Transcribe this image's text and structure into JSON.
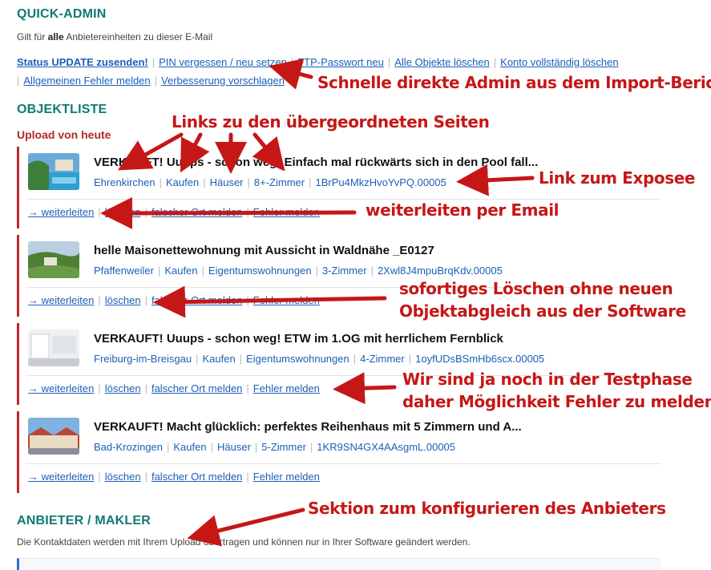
{
  "quick_admin": {
    "title": "QUICK-ADMIN",
    "subtitle_pre": "Gilt für ",
    "subtitle_bold": "alle",
    "subtitle_post": " Anbietereinheiten zu dieser E-Mail",
    "links": [
      "Status UPDATE zusenden!",
      "PIN vergessen / neu setzen",
      "FTP-Passwort neu",
      "Alle Objekte löschen",
      "Konto vollständig löschen",
      "Allgemeinen Fehler melden",
      "Verbesserung vorschlagen"
    ]
  },
  "objektliste": {
    "title": "OBJEKTLISTE",
    "upload_heading": "Upload von heute",
    "listings": [
      {
        "title": "VERKAUFT! Uuups - schon weg: Einfach mal rückwärts sich in den Pool fall...",
        "city": "Ehrenkirchen",
        "deal": "Kaufen",
        "type": "Häuser",
        "rooms": "8+-Zimmer",
        "id": "1BrPu4MkzHvoYvPQ.00005",
        "actions": [
          "→ weiterleiten",
          "löschen",
          "falscher Ort melden",
          "Fehler melden"
        ]
      },
      {
        "title": "helle Maisonettewohnung mit Aussicht in Waldnähe _E0127",
        "city": "Pfaffenweiler",
        "deal": "Kaufen",
        "type": "Eigentumswohnungen",
        "rooms": "3-Zimmer",
        "id": "2Xwl8J4mpuBrqKdv.00005",
        "actions": [
          "→ weiterleiten",
          "löschen",
          "falscher Ort melden",
          "Fehler melden"
        ]
      },
      {
        "title": "VERKAUFT! Uuups - schon weg! ETW im 1.OG mit herrlichem Fernblick",
        "city": "Freiburg-im-Breisgau",
        "deal": "Kaufen",
        "type": "Eigentumswohnungen",
        "rooms": "4-Zimmer",
        "id": "1oyfUDsBSmHb6scx.00005",
        "actions": [
          "→ weiterleiten",
          "löschen",
          "falscher Ort melden",
          "Fehler melden"
        ]
      },
      {
        "title": "VERKAUFT! Macht glücklich: perfektes Reihenhaus mit 5 Zimmern und A...",
        "city": "Bad-Krozingen",
        "deal": "Kaufen",
        "type": "Häuser",
        "rooms": "5-Zimmer",
        "id": "1KR9SN4GX4AAsgmL.00005",
        "actions": [
          "→ weiterleiten",
          "löschen",
          "falscher Ort melden",
          "Fehler melden"
        ]
      }
    ]
  },
  "anbieter": {
    "title": "ANBIETER / MAKLER",
    "subtitle": "Die Kontaktdaten werden mit Ihrem Upload übertragen und können nur in Ihrer Software geändert werden."
  },
  "annotations": {
    "admin": "Schnelle direkte Admin aus dem Import-Bericht",
    "parent_links": "Links zu den übergeordneten Seiten",
    "expose": "Link zum Exposee",
    "forward": "weiterleiten per Email",
    "delete_line1": "sofortiges Löschen ohne neuen",
    "delete_line2": "Objektabgleich aus der Software",
    "report_line1": "Wir sind ja noch in der Testphase",
    "report_line2": "daher Möglichkeit Fehler zu melden",
    "provider": "Sektion zum konfigurieren des Anbieters",
    "color": "#c61717"
  }
}
